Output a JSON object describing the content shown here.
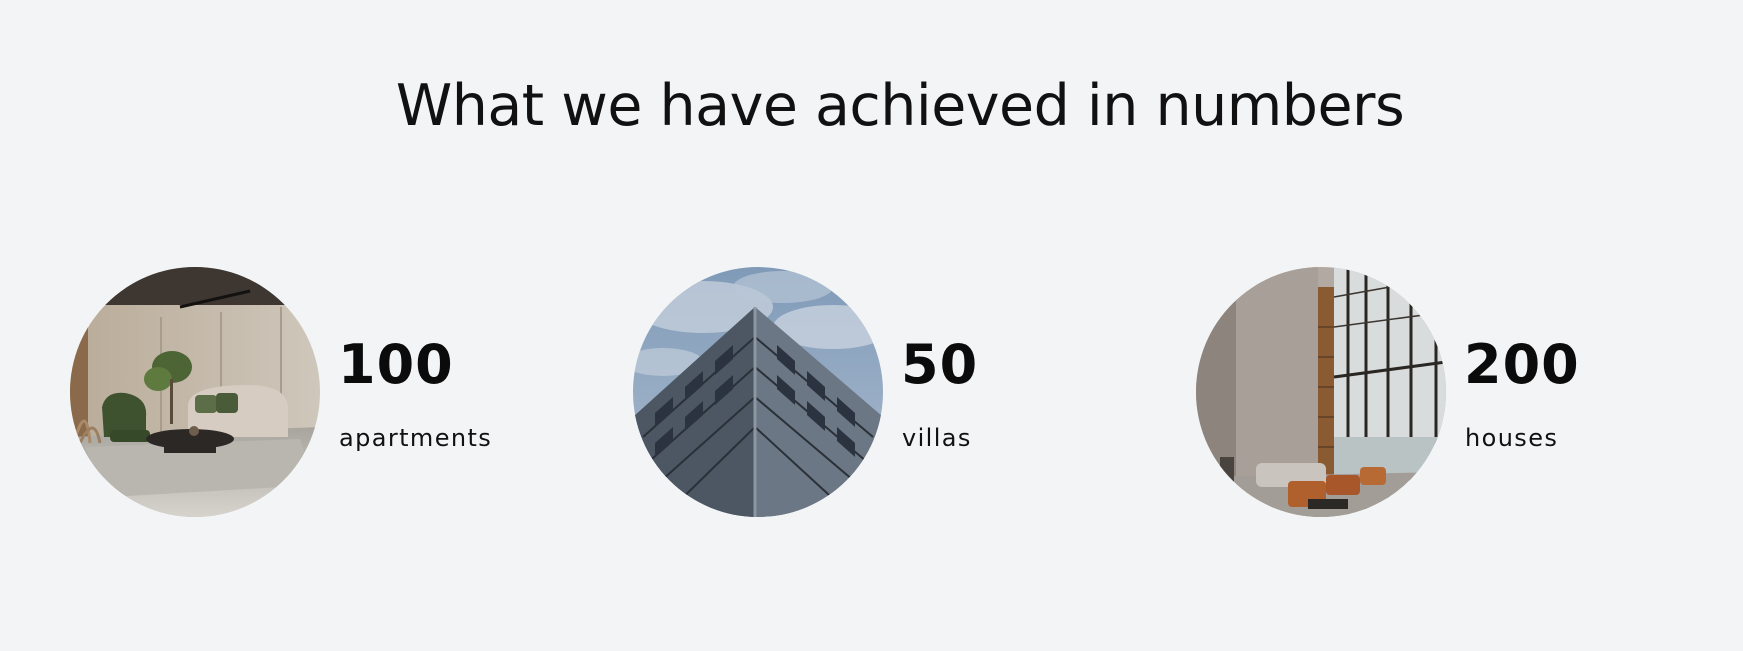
{
  "heading": "What we have achieved in numbers",
  "stats": [
    {
      "number": "100",
      "label": "apartments",
      "image": "living-room-interior"
    },
    {
      "number": "50",
      "label": "villas",
      "image": "building-facade"
    },
    {
      "number": "200",
      "label": "houses",
      "image": "lobby-interior"
    }
  ],
  "colors": {
    "background": "#f3f4f6",
    "text": "#111111"
  }
}
